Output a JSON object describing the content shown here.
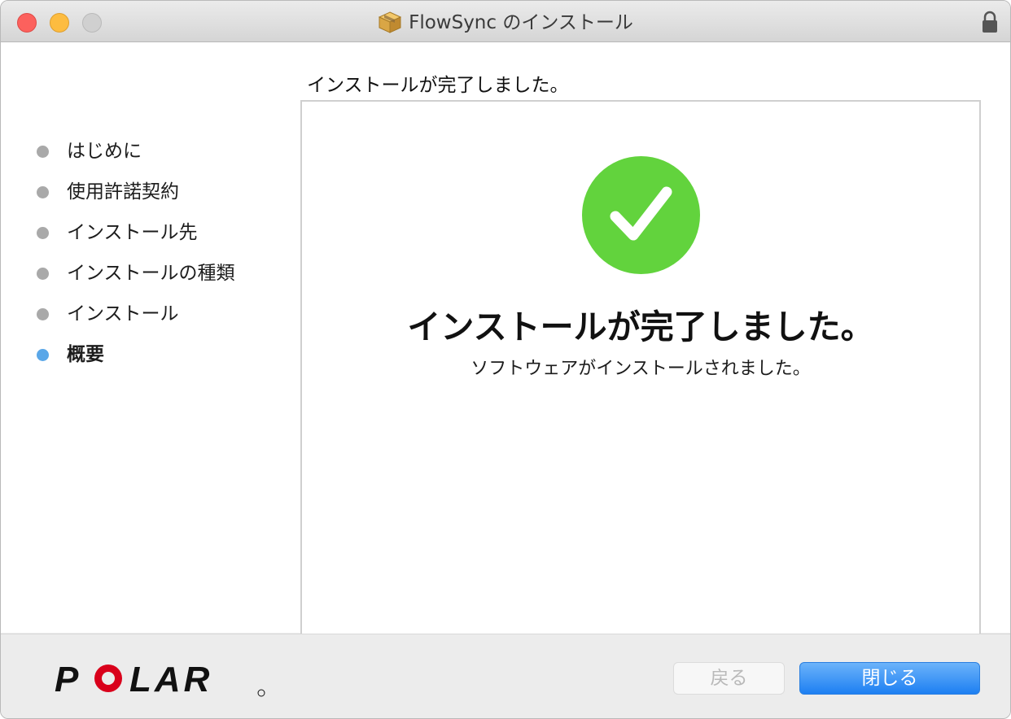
{
  "window": {
    "title": "FlowSync のインストール"
  },
  "sidebar": {
    "steps": [
      {
        "label": "はじめに",
        "state": "done"
      },
      {
        "label": "使用許諾契約",
        "state": "done"
      },
      {
        "label": "インストール先",
        "state": "done"
      },
      {
        "label": "インストールの種類",
        "state": "done"
      },
      {
        "label": "インストール",
        "state": "done"
      },
      {
        "label": "概要",
        "state": "current"
      }
    ]
  },
  "main": {
    "header": "インストールが完了しました。",
    "heading": "インストールが完了しました。",
    "message": "ソフトウェアがインストールされました。"
  },
  "footer": {
    "logo_text": "POLAR",
    "back_label": "戻る",
    "close_label": "閉じる"
  },
  "colors": {
    "success_green": "#62d33d",
    "accent_blue": "#1d7ff2",
    "current_step_dot": "#5aa7e8",
    "done_step_dot": "#a9a9a9"
  }
}
